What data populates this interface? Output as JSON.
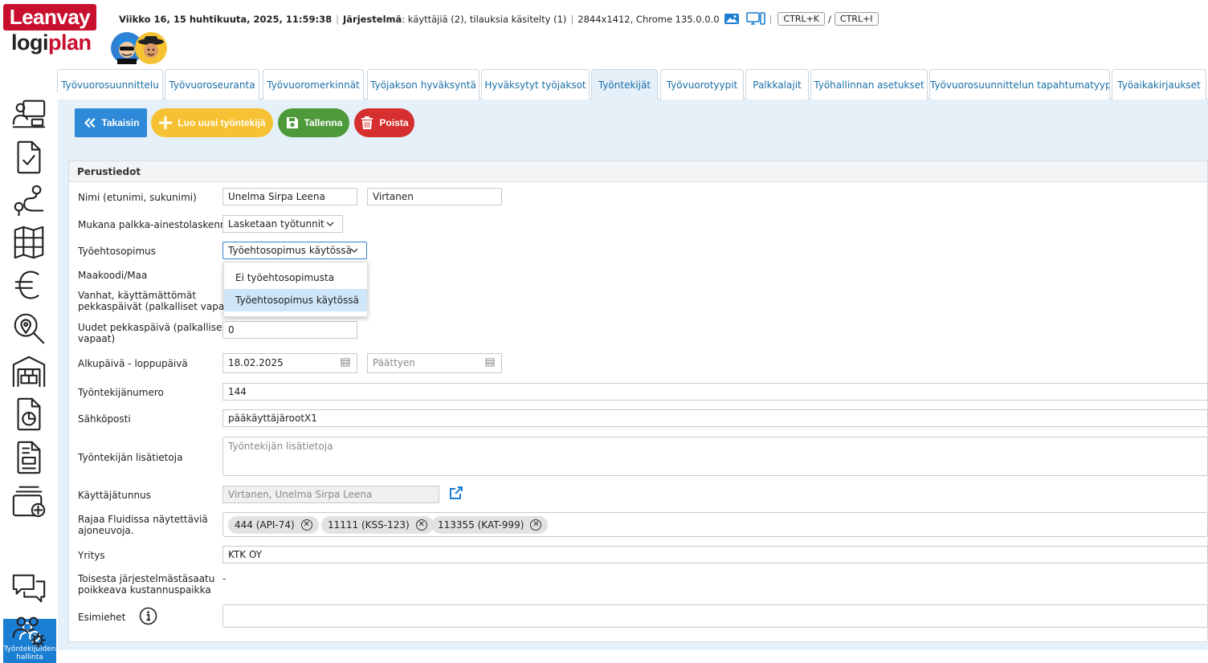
{
  "brand": {
    "logo_top": "Leanvay",
    "logo_bottom_1": "logi",
    "logo_bottom_2": "plan"
  },
  "status": {
    "datetime": "Viikko 16, 15 huhtikuuta, 2025, 11:59:38",
    "system_label": "Järjestelmä",
    "system_text": ": käyttäjiä (2), tilauksia käsitelty (1)",
    "resolution": "2844x1412, Chrome 135.0.0.0",
    "shortcut_1": "CTRL+K",
    "shortcut_sep": "/",
    "shortcut_2": "CTRL+I"
  },
  "tabs": [
    {
      "label": "Työvuorosuunnittelu",
      "active": false
    },
    {
      "label": "Työvuoroseuranta",
      "active": false
    },
    {
      "label": "Työvuoromerkinnät",
      "active": false
    },
    {
      "label": "Työjakson hyväksyntä",
      "active": false
    },
    {
      "label": "Hyväksytyt työjaksot",
      "active": false
    },
    {
      "label": "Työntekijät",
      "active": true
    },
    {
      "label": "Työvuorotyypit",
      "active": false
    },
    {
      "label": "Palkkalajit",
      "active": false
    },
    {
      "label": "Työhallinnan asetukset",
      "active": false
    },
    {
      "label": "Työvuorosuunnittelun tapahtumatyypit",
      "active": false
    },
    {
      "label": "Työaikakirjaukset",
      "active": false
    }
  ],
  "sidebar": {
    "icons": [
      "desk-icon",
      "document-check-icon",
      "route-icon",
      "map-icon",
      "euro-icon",
      "search-location-icon",
      "warehouse-icon",
      "report-chart-icon",
      "invoice-icon",
      "add-stack-icon",
      "employee-management-icon",
      "chat-icon",
      "users-settings-icon"
    ],
    "active_label": "Työntekijöiden hallinta"
  },
  "toolbar": {
    "back": "Takaisin",
    "new": "Luo uusi työntekijä",
    "save": "Tallenna",
    "delete": "Poista",
    "colors": {
      "back": "#2e8ad8",
      "new": "#f6c233",
      "save": "#4e9a3a",
      "delete": "#d62f2f"
    }
  },
  "form": {
    "section_title": "Perustiedot",
    "name_label": "Nimi (etunimi, sukunimi)",
    "first_name": "Unelma Sirpa Leena",
    "last_name": "Virtanen",
    "payroll_label": "Mukana palkka-ainestolaskennassa",
    "payroll_value": "Lasketaan työtunnit",
    "contract_label": "Työehtosopimus",
    "contract_value": "Työehtosopimus käytössä",
    "contract_options": [
      "Ei työehtosopimusta",
      "Työehtosopimus käytössä"
    ],
    "country_label": "Maakoodi/Maa",
    "old_days_label_1": "Vanhat, käyttämättömät",
    "old_days_label_2": "pekkaspäivät (palkalliset vapaat)",
    "new_days_label_1": "Uudet pekkaspäivä (palkalliset",
    "new_days_label_2": "vapaat)",
    "new_days_value": "0",
    "dates_label": "Alkupäivä - loppupäivä",
    "start_date": "18.02.2025",
    "end_placeholder": "Päättyen",
    "emp_no_label": "Työntekijänumero",
    "emp_no": "144",
    "email_label": "Sähköposti",
    "email": "pääkäyttäjärootX1",
    "info_label": "Työntekijän lisätietoja",
    "info_placeholder": "Työntekijän lisätietoja",
    "user_label": "Käyttäjätunnus",
    "user_value": "Virtanen, Unelma Sirpa Leena",
    "vehicles_label_1": "Rajaa Fluidissa näytettäviä",
    "vehicles_label_2": "ajoneuvoja.",
    "vehicles": [
      "444 (API-74)",
      "11111 (KSS-123)",
      "113355 (KAT-999)"
    ],
    "company_label": "Yritys",
    "company": "KTK OY",
    "cost_label_1": "Toisesta järjestelmästäsaatu",
    "cost_label_2": "poikkeava kustannuspaikka",
    "cost_value": "-",
    "supervisors_label": "Esimiehet"
  }
}
